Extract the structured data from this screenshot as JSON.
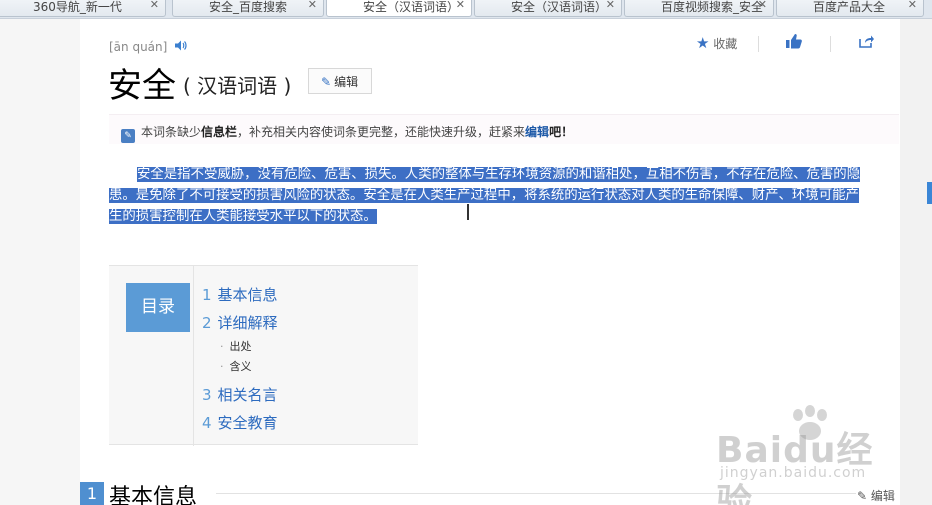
{
  "tabs": [
    {
      "label": "360导航_新一代",
      "close": "✕"
    },
    {
      "label": "安全_百度搜索",
      "close": "✕"
    },
    {
      "label": "安全（汉语词语）",
      "close": "✕"
    },
    {
      "label": "安全（汉语词语）",
      "close": "✕"
    },
    {
      "label": "百度视频搜索_安全",
      "close": "✕"
    },
    {
      "label": "百度产品大全",
      "close": "✕"
    }
  ],
  "entry": {
    "pinyin": "[ān quán]",
    "title": "安全",
    "subtitle": "( 汉语词语 )",
    "edit_label": "编辑"
  },
  "actions": {
    "favorite_label": "收藏"
  },
  "notice": {
    "text_before": "本词条缺少",
    "highlight": "信息栏",
    "text_middle": "，补充相关内容使词条更完整，还能快速升级，赶紧来",
    "link": "编辑",
    "text_after": "吧！"
  },
  "paragraph": {
    "line1": "安全是指不受威胁，没有危险、危害、损失。人类的整体与生存环境资源的和谐相处，互相不伤害，不存在危险、危害的隐",
    "line2": "患。是免除了不可接受的损害风险的状态。安全是在人类生产过程中，将系统的运行状态对人类的生命保障、财产、环境可能产",
    "line3": "生的损害控制在人类能接受水平以下的状态。"
  },
  "toc": {
    "label": "目录",
    "items": [
      {
        "num": "1",
        "label": "基本信息"
      },
      {
        "num": "2",
        "label": "详细解释"
      },
      {
        "num": "3",
        "label": "相关名言"
      },
      {
        "num": "4",
        "label": "安全教育"
      }
    ],
    "subitems": [
      {
        "dot": "·",
        "label": "出处"
      },
      {
        "dot": "·",
        "label": "含义"
      }
    ]
  },
  "section": {
    "num": "1",
    "title": "基本信息",
    "edit_label": "编辑"
  },
  "watermark": {
    "main": "Baidu经验",
    "sub": "jingyan.baidu.com"
  }
}
